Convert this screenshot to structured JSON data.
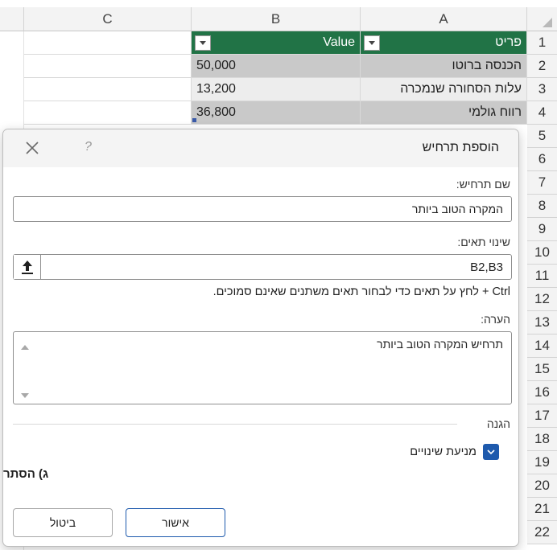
{
  "sheet": {
    "columns": [
      "A",
      "B",
      "C"
    ],
    "rows": [
      "1",
      "2",
      "3",
      "4",
      "5",
      "6",
      "7",
      "8",
      "9",
      "10",
      "11",
      "12",
      "13",
      "14",
      "15",
      "16",
      "17",
      "18",
      "19",
      "20",
      "21",
      "22"
    ],
    "table": {
      "header": {
        "item": "פריט",
        "value": "Value"
      },
      "data": [
        {
          "item": "הכנסה ברוטו",
          "value": "50,000"
        },
        {
          "item": "עלות הסחורה שנמכרה",
          "value": "13,200"
        },
        {
          "item": "רווח גולמי",
          "value": "36,800"
        }
      ]
    }
  },
  "dialog": {
    "title": "הוספת תרחיש",
    "help": "?",
    "scenario_name_label": "שם תרחיש:",
    "scenario_name_value": "המקרה הטוב ביותר",
    "changing_cells_label": "שינוי תאים:",
    "changing_cells_value": "B2,B3",
    "hint": "Ctrl + לחץ על תאים כדי לבחור תאים משתנים שאינם סמוכים.",
    "comment_label": "הערה:",
    "comment_value": "תרחיש המקרה הטוב ביותר",
    "protection_label": "הגנה",
    "prevent_changes_label": "מניעת שינויים",
    "hide_label_clipped": "ג) הסתר",
    "ok_label": "אישור",
    "cancel_label": "ביטול"
  },
  "colors": {
    "header_green": "#217346",
    "checkbox_blue": "#1e5aad",
    "selected_gray": "#c9c9c9"
  }
}
